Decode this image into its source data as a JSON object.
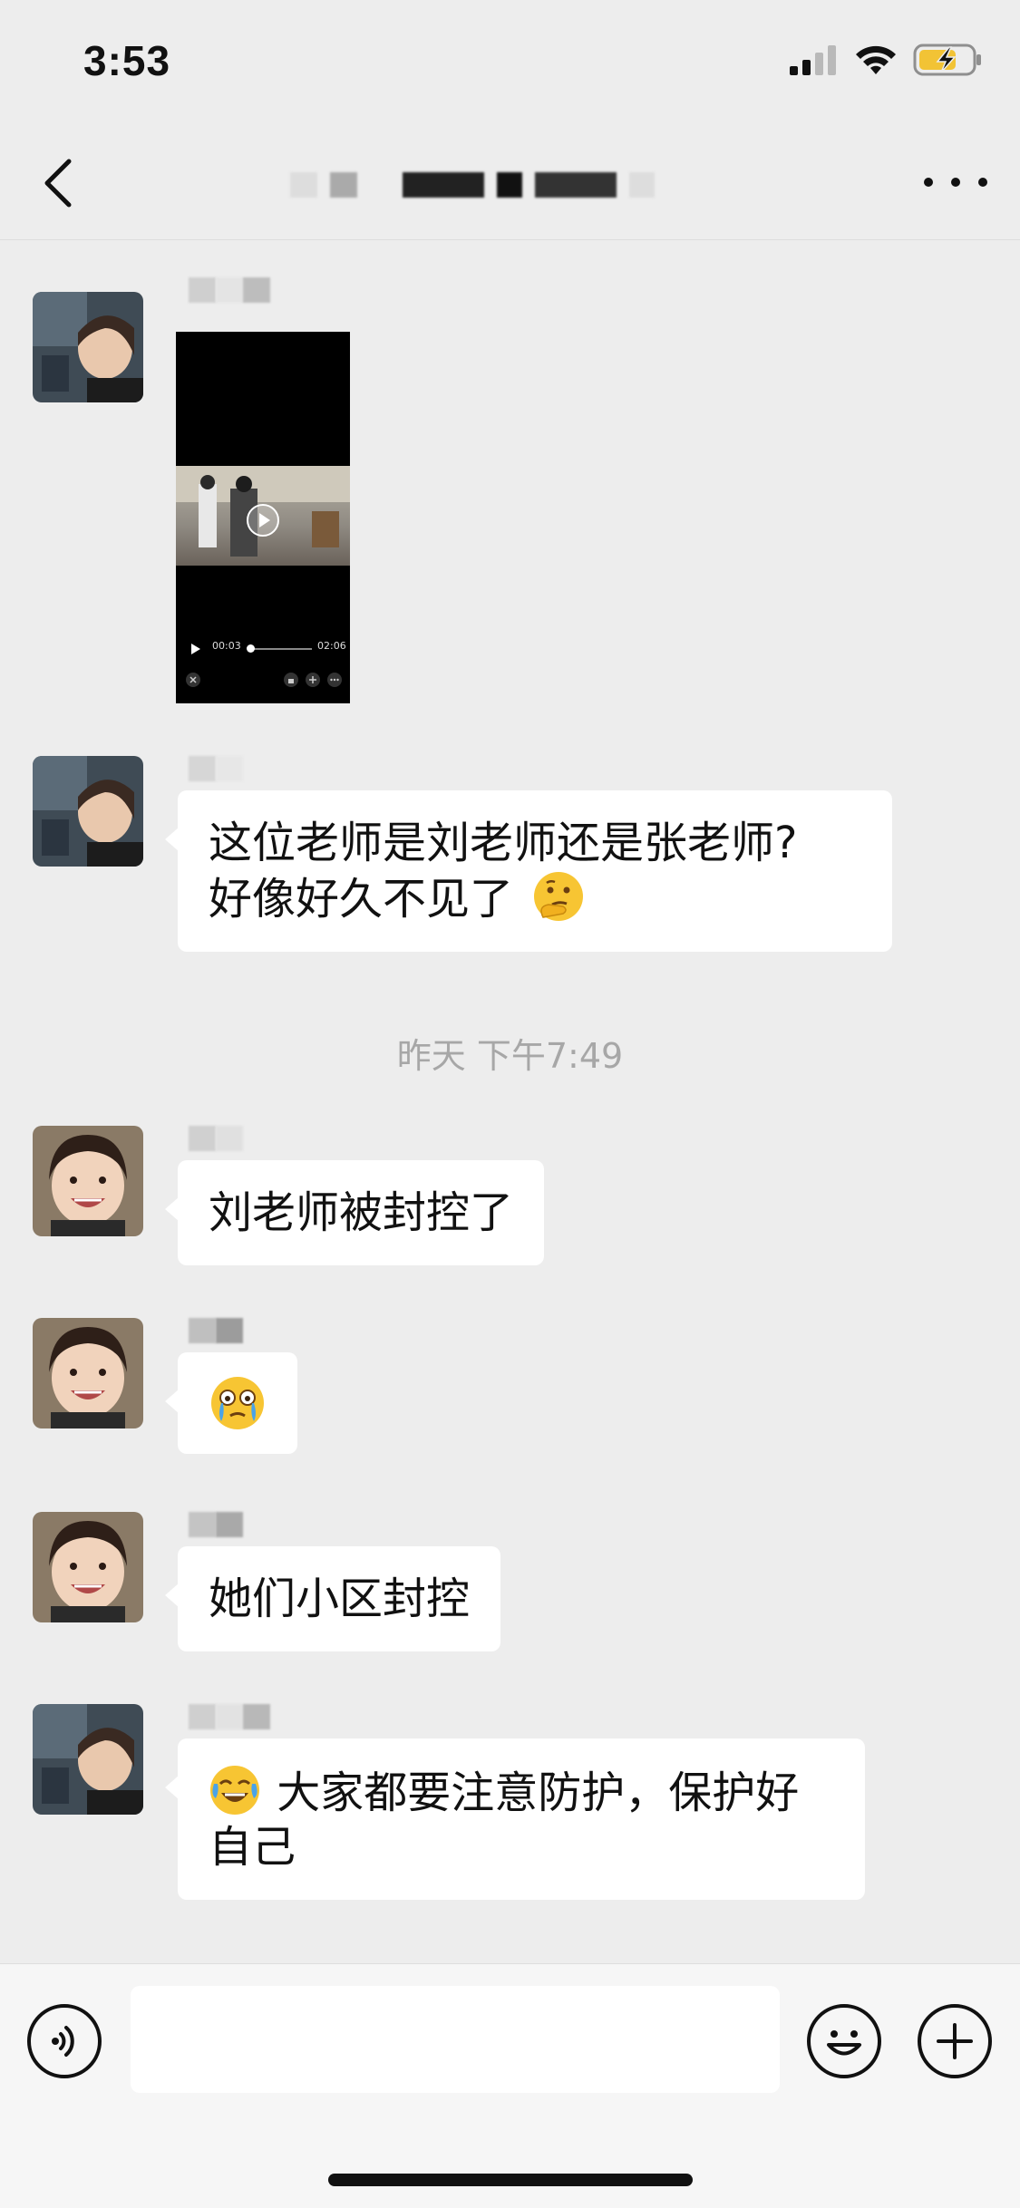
{
  "status_bar": {
    "time": "3:53",
    "icons": [
      "signal-icon",
      "wifi-icon",
      "battery-charging-icon"
    ]
  },
  "nav": {
    "back_icon": "chevron-left-icon",
    "more_icon": "more-dots-icon"
  },
  "chat": {
    "messages": [
      {
        "type": "video",
        "video": {
          "elapsed": "00:03",
          "duration": "02:06"
        }
      },
      {
        "type": "text",
        "text_lines": [
          "这位老师是刘老师还是张老师?",
          "好像好久不见了"
        ],
        "emoji": "thinking-face-icon"
      },
      {
        "type": "text",
        "text_lines": [
          "刘老师被封控了"
        ]
      },
      {
        "type": "emoji",
        "emoji": "crying-face-icon"
      },
      {
        "type": "text",
        "text_lines": [
          "她们小区封控"
        ]
      },
      {
        "type": "text",
        "text_lines": [
          "大家都要注意防护，保护好",
          "自己"
        ],
        "emoji": "tears-of-joy-icon"
      }
    ],
    "timestamp": "昨天 下午7:49"
  },
  "input_bar": {
    "voice_icon": "voice-icon",
    "input_value": "",
    "emoji_icon": "smiley-icon",
    "plus_icon": "plus-circle-icon"
  }
}
